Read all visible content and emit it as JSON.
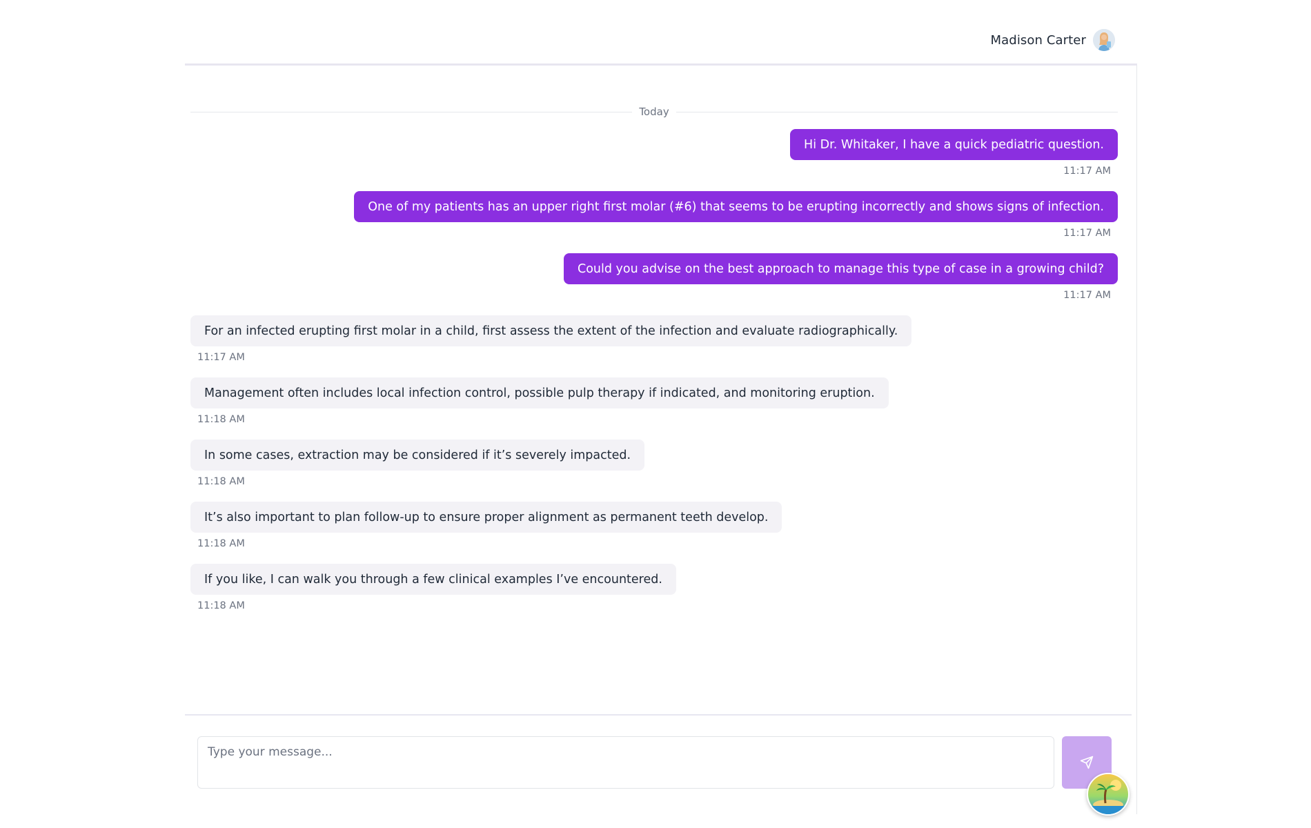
{
  "header": {
    "user_name": "Madison Carter",
    "avatar_icon": "user-avatar-icon"
  },
  "chat": {
    "date_divider": "Today",
    "messages": [
      {
        "direction": "outgoing",
        "text": "Hi Dr. Whitaker, I have a quick pediatric question.",
        "time": "11:17 AM"
      },
      {
        "direction": "outgoing",
        "text": "One of my patients has an upper right first molar (#6) that seems to be erupting incorrectly and shows signs of infection.",
        "time": "11:17 AM"
      },
      {
        "direction": "outgoing",
        "text": "Could you advise on the best approach to manage this type of case in a growing child?",
        "time": "11:17 AM"
      },
      {
        "direction": "incoming",
        "text": "For an infected erupting first molar in a child, first assess the extent of the infection and evaluate radiographically.",
        "time": "11:17 AM"
      },
      {
        "direction": "incoming",
        "text": "Management often includes local infection control, possible pulp therapy if indicated, and monitoring eruption.",
        "time": "11:18 AM"
      },
      {
        "direction": "incoming",
        "text": "In some cases, extraction may be considered if it’s severely impacted.",
        "time": "11:18 AM"
      },
      {
        "direction": "incoming",
        "text": "It’s also important to plan follow-up to ensure proper alignment as permanent teeth develop.",
        "time": "11:18 AM"
      },
      {
        "direction": "incoming",
        "text": "If you like, I can walk you through a few clinical examples I’ve encountered.",
        "time": "11:18 AM"
      }
    ]
  },
  "composer": {
    "placeholder": "Type your message...",
    "value": "",
    "send_icon": "send-icon"
  },
  "floating_badge": {
    "icon": "beach-island-icon"
  },
  "colors": {
    "outgoing_bubble": "#8b2fe0",
    "incoming_bubble": "#f3f2f6",
    "send_button": "#c9a7f0",
    "timestamp": "#6b7280"
  }
}
